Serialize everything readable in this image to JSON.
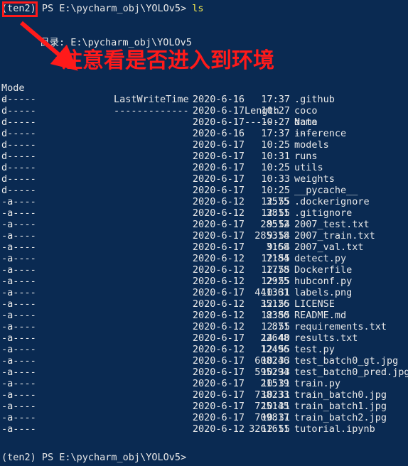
{
  "terminal": {
    "background_color": "#0A2A52",
    "text_color": "#E8E8E8",
    "command_color": "#F2E750",
    "annotation_color": "#FF1A1A",
    "prompt_top": "(ten2) PS E:\\pycharm_obj\\YOLOv5> ",
    "command": "ls",
    "directory_label": "目录: E:\\pycharm_obj\\YOLOv5",
    "prompt_bottom": "(ten2) PS E:\\pycharm_obj\\YOLOv5>",
    "env_name": "(ten2)"
  },
  "annotations": {
    "note_text": "注意看是否进入到环境",
    "box_target": "(ten2)",
    "arrow_from": "(30,32)",
    "arrow_to": "(100,92)"
  },
  "table": {
    "headers": {
      "mode": "Mode",
      "lastwritetime": "LastWriteTime",
      "length": "Length",
      "name": "Name"
    },
    "dividers": {
      "mode": "----",
      "lastwritetime": "-------------",
      "length": "------",
      "name": "----"
    },
    "rows": [
      {
        "mode": "d-----",
        "date": "2020-6-16",
        "time": "17:37",
        "length": "",
        "name": ".github"
      },
      {
        "mode": "d-----",
        "date": "2020-6-17",
        "time": "10:27",
        "length": "",
        "name": "coco"
      },
      {
        "mode": "d-----",
        "date": "2020-6-17",
        "time": "10:27",
        "length": "",
        "name": "data"
      },
      {
        "mode": "d-----",
        "date": "2020-6-16",
        "time": "17:37",
        "length": "",
        "name": "inference"
      },
      {
        "mode": "d-----",
        "date": "2020-6-17",
        "time": "10:25",
        "length": "",
        "name": "models"
      },
      {
        "mode": "d-----",
        "date": "2020-6-17",
        "time": "10:31",
        "length": "",
        "name": "runs"
      },
      {
        "mode": "d-----",
        "date": "2020-6-17",
        "time": "10:25",
        "length": "",
        "name": "utils"
      },
      {
        "mode": "d-----",
        "date": "2020-6-17",
        "time": "10:33",
        "length": "",
        "name": "weights"
      },
      {
        "mode": "d-----",
        "date": "2020-6-17",
        "time": "10:25",
        "length": "",
        "name": "__pycache__"
      },
      {
        "mode": "-a----",
        "date": "2020-6-12",
        "time": "12:55",
        "length": "3575",
        "name": ".dockerignore"
      },
      {
        "mode": "-a----",
        "date": "2020-6-12",
        "time": "12:55",
        "length": "3811",
        "name": ".gitignore"
      },
      {
        "mode": "-a----",
        "date": "2020-6-17",
        "time": "9:54",
        "length": "28512",
        "name": "2007_test.txt"
      },
      {
        "mode": "-a----",
        "date": "2020-6-17",
        "time": "9:54",
        "length": "285318",
        "name": "2007_train.txt"
      },
      {
        "mode": "-a----",
        "date": "2020-6-17",
        "time": "9:54",
        "length": "3168",
        "name": "2007_val.txt"
      },
      {
        "mode": "-a----",
        "date": "2020-6-12",
        "time": "12:55",
        "length": "7184",
        "name": "detect.py"
      },
      {
        "mode": "-a----",
        "date": "2020-6-12",
        "time": "12:55",
        "length": "1778",
        "name": "Dockerfile"
      },
      {
        "mode": "-a----",
        "date": "2020-6-12",
        "time": "12:55",
        "length": "2925",
        "name": "hubconf.py"
      },
      {
        "mode": "-a----",
        "date": "2020-6-17",
        "time": "10:31",
        "length": "441361",
        "name": "labels.png"
      },
      {
        "mode": "-a----",
        "date": "2020-6-12",
        "time": "12:55",
        "length": "35126",
        "name": "LICENSE"
      },
      {
        "mode": "-a----",
        "date": "2020-6-12",
        "time": "12:55",
        "length": "8380",
        "name": "README.md"
      },
      {
        "mode": "-a----",
        "date": "2020-6-12",
        "time": "12:55",
        "length": "871",
        "name": "requirements.txt"
      },
      {
        "mode": "-a----",
        "date": "2020-6-17",
        "time": "14:40",
        "length": "22648",
        "name": "results.txt"
      },
      {
        "mode": "-a----",
        "date": "2020-6-12",
        "time": "12:55",
        "length": "12496",
        "name": "test.py"
      },
      {
        "mode": "-a----",
        "date": "2020-6-17",
        "time": "10:33",
        "length": "608246",
        "name": "test_batch0_gt.jpg"
      },
      {
        "mode": "-a----",
        "date": "2020-6-17",
        "time": "10:33",
        "length": "595294",
        "name": "test_batch0_pred.jpg"
      },
      {
        "mode": "-a----",
        "date": "2020-6-17",
        "time": "10:31",
        "length": "21519",
        "name": "train.py"
      },
      {
        "mode": "-a----",
        "date": "2020-6-17",
        "time": "10:31",
        "length": "738233",
        "name": "train_batch0.jpg"
      },
      {
        "mode": "-a----",
        "date": "2020-6-17",
        "time": "10:31",
        "length": "725145",
        "name": "train_batch1.jpg"
      },
      {
        "mode": "-a----",
        "date": "2020-6-17",
        "time": "10:31",
        "length": "709817",
        "name": "train_batch2.jpg"
      },
      {
        "mode": "-a----",
        "date": "2020-6-12",
        "time": "12:55",
        "length": "3261611",
        "name": "tutorial.ipynb"
      }
    ]
  }
}
